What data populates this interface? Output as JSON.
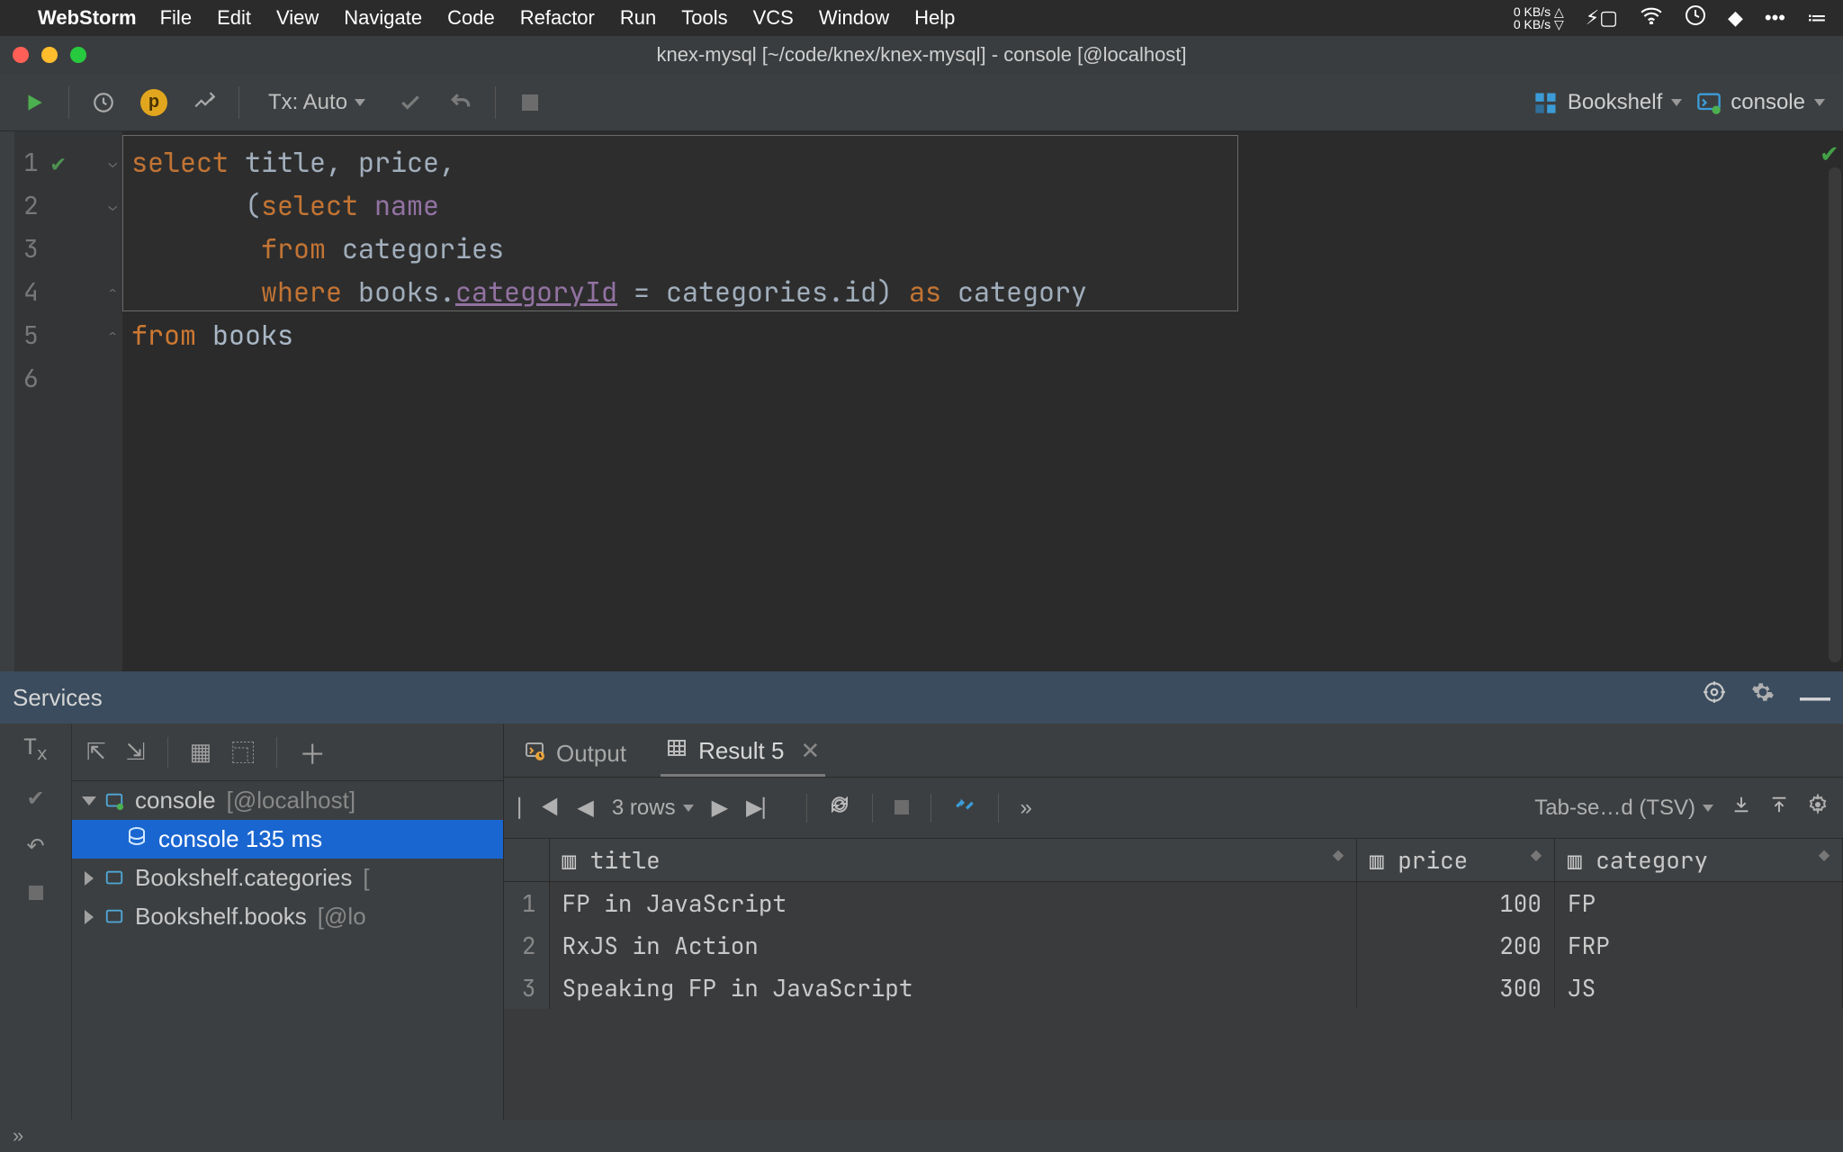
{
  "mac_menu": {
    "app_name": "WebStorm",
    "items": [
      "File",
      "Edit",
      "View",
      "Navigate",
      "Code",
      "Refactor",
      "Run",
      "Tools",
      "VCS",
      "Window",
      "Help"
    ],
    "net_up": "0 KB/s △",
    "net_down": "0 KB/s ▽"
  },
  "titlebar": {
    "title": "knex-mysql [~/code/knex/knex-mysql] - console [@localhost]"
  },
  "toolbar": {
    "tx_label": "Tx: Auto",
    "datasource": "Bookshelf",
    "console": "console"
  },
  "editor": {
    "line_numbers": [
      "1",
      "2",
      "3",
      "4",
      "5",
      "6"
    ],
    "lines": [
      [
        {
          "t": "select ",
          "c": "kw"
        },
        {
          "t": "title",
          "c": "id"
        },
        {
          "t": ", ",
          "c": "id"
        },
        {
          "t": "price",
          "c": "id"
        },
        {
          "t": ",",
          "c": "id"
        }
      ],
      [
        {
          "t": "       (",
          "c": "id"
        },
        {
          "t": "select ",
          "c": "kw"
        },
        {
          "t": "name",
          "c": "col"
        }
      ],
      [
        {
          "t": "        ",
          "c": ""
        },
        {
          "t": "from ",
          "c": "kw"
        },
        {
          "t": "categories",
          "c": "id"
        }
      ],
      [
        {
          "t": "        ",
          "c": ""
        },
        {
          "t": "where ",
          "c": "kw"
        },
        {
          "t": "books.",
          "c": "id"
        },
        {
          "t": "categoryId",
          "c": "col u"
        },
        {
          "t": " = categories.",
          "c": "id"
        },
        {
          "t": "id",
          "c": "id"
        },
        {
          "t": ")",
          "c": "id"
        },
        {
          "t": " as ",
          "c": "kw"
        },
        {
          "t": "category",
          "c": "id"
        }
      ],
      [
        {
          "t": "from ",
          "c": "kw"
        },
        {
          "t": "books",
          "c": "id"
        }
      ],
      [
        {
          "t": "",
          "c": ""
        }
      ]
    ]
  },
  "services": {
    "title": "Services",
    "tree": {
      "root_label": "console",
      "root_host": "[@localhost]",
      "selected_label": "console 135 ms",
      "categories_label": "Bookshelf.categories",
      "categories_host": "[",
      "books_label": "Bookshelf.books",
      "books_host": "[@lo"
    }
  },
  "tabs": {
    "output": "Output",
    "result": "Result 5"
  },
  "result_toolbar": {
    "rows": "3 rows",
    "export": "Tab-se…d (TSV)"
  },
  "table": {
    "columns": [
      "title",
      "price",
      "category"
    ],
    "rows": [
      {
        "n": "1",
        "title": "FP in JavaScript",
        "price": "100",
        "category": "FP"
      },
      {
        "n": "2",
        "title": "RxJS in Action",
        "price": "200",
        "category": "FRP"
      },
      {
        "n": "3",
        "title": "Speaking FP in JavaScript",
        "price": "300",
        "category": "JS"
      }
    ]
  }
}
